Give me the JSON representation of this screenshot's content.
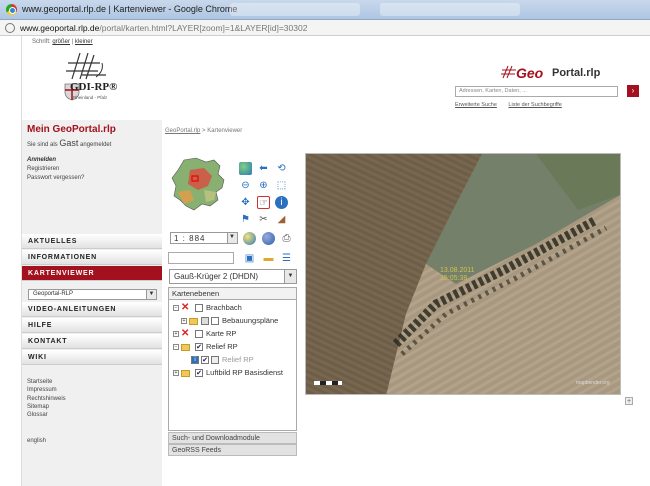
{
  "browser": {
    "window_title": "www.geoportal.rlp.de | Kartenviewer - Google Chrome",
    "url_host": "www.geoportal.rlp.de",
    "url_path": "/portal/karten.html?LAYER[zoom]=1&LAYER[id]=30302"
  },
  "header": {
    "font_size_label": "Schrift:",
    "font_bigger": "größer",
    "font_sep": "|",
    "font_smaller": "kleiner",
    "gdi_logo_text": "GDI-RP®",
    "gdi_logo_sub": "Rheinland - Pfalz",
    "geoportal_logo_geo": "Geo",
    "geoportal_logo_portal": "Portal.rlp",
    "search_placeholder": "Adressen, Karten, Daten, ...",
    "search_button": "›",
    "link_advanced": "Erweiterte Suche",
    "link_terms": "Liste der Suchbegriffe"
  },
  "sidebar": {
    "title": "Mein GeoPortal.rlp",
    "greeting_pre": "Sie sind als",
    "greeting_user": "Gast",
    "greeting_post": "angemeldet",
    "login_heading": "Anmelden",
    "register": "Registrieren",
    "forgot": "Passwort vergessen?",
    "nav": [
      {
        "label": "AKTUELLES"
      },
      {
        "label": "INFORMATIONEN"
      },
      {
        "label": "KARTENVIEWER"
      },
      {
        "label": "VIDEO-ANLEITUNGEN"
      },
      {
        "label": "HILFE"
      },
      {
        "label": "KONTAKT"
      },
      {
        "label": "WIKI"
      }
    ],
    "gui_select": "Geoportal-RLP",
    "footer_links": [
      "Startseite",
      "Impressum",
      "Rechtshinweis",
      "Sitemap",
      "Glossar"
    ],
    "language": "english"
  },
  "breadcrumb": {
    "home": "GeoPortal.rlp",
    "sep": ">",
    "current": "Kartenviewer"
  },
  "viewer": {
    "scale": "1 : 884",
    "projection": "Gauß-Krüger 2 (DHDN)",
    "layers_header": "Kartenebenen",
    "layers": [
      {
        "label": "Brachbach",
        "checked": false
      },
      {
        "label": "Bebauungspläne",
        "checked": false
      },
      {
        "label": "Karte RP",
        "checked": false
      },
      {
        "label": "Relief RP",
        "checked": true
      },
      {
        "label": "Relief RP",
        "checked": true
      },
      {
        "label": "Luftbild RP Basisdienst",
        "checked": true
      }
    ],
    "panel_search": "Such- und Downloadmodule",
    "panel_georss": "GeoRSS Feeds",
    "map_overlay_line1": "13.08.2011",
    "map_overlay_line2": "15:05:38",
    "map_credit": "mapbender.org",
    "zoom_plus": "+"
  },
  "colors": {
    "accent": "#a4111e"
  }
}
